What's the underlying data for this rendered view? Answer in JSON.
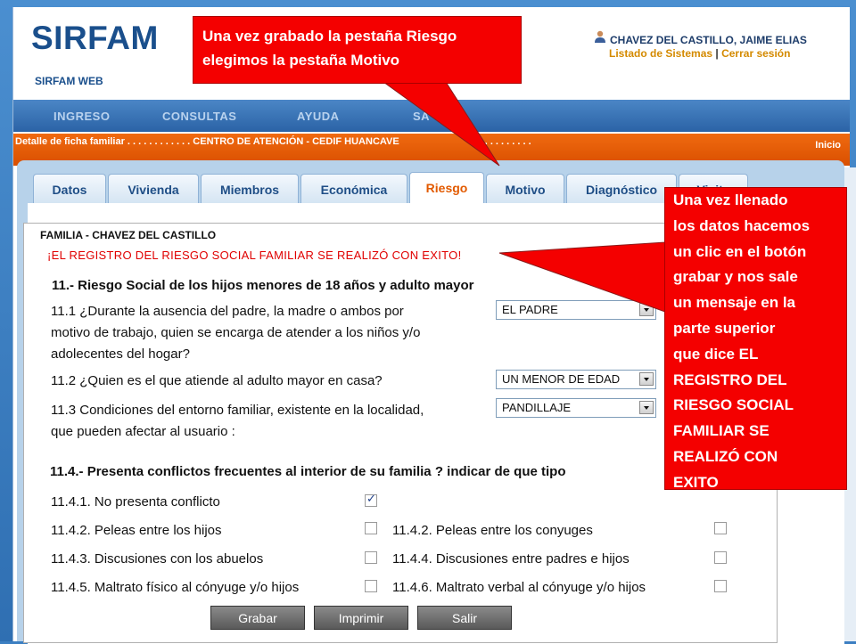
{
  "app": {
    "logo": "SIRFAM",
    "subtitle": "SIRFAM WEB",
    "user_name": "CHAVEZ DEL CASTILLO, JAIME ELIAS",
    "link_systems": "Listado de Sistemas",
    "link_separator": "|",
    "link_logout": "Cerrar sesión"
  },
  "nav": {
    "items": [
      "INGRESO",
      "CONSULTAS",
      "AYUDA",
      "SA"
    ]
  },
  "breadcrumb": {
    "text": "Detalle de ficha familiar . . . . . . . . . . . . CENTRO DE ATENCIÓN - CEDIF HUANCAVE",
    "dots": ". . . . . . . . .",
    "home": "Inicio"
  },
  "tabs": [
    "Datos",
    "Vivienda",
    "Miembros",
    "Económica",
    "Riesgo",
    "Motivo",
    "Diagnóstico",
    "Visita"
  ],
  "active_tab": "Riesgo",
  "form": {
    "family": "FAMILIA - CHAVEZ DEL CASTILLO",
    "success_message": "¡EL REGISTRO DEL RIESGO SOCIAL FAMILIAR SE REALIZÓ CON EXITO!",
    "section_11": "11.- Riesgo Social de los hijos menores de 18 años y adulto mayor",
    "q11_1": [
      "11.1 ¿Durante la ausencia del padre, la madre o ambos por",
      "motivo de trabajo, quien se encarga de atender a los niños y/o",
      "adolecentes del hogar?"
    ],
    "q11_1_value": "EL PADRE",
    "q11_2": "11.2 ¿Quien es el que atiende al adulto mayor en casa?",
    "q11_2_value": "UN MENOR DE EDAD",
    "q11_3": [
      "11.3 Condiciones del entorno familiar, existente en la localidad,",
      "que pueden afectar al usuario :"
    ],
    "q11_3_value": "PANDILLAJE",
    "section_114": "11.4.- Presenta conflictos frecuentes al interior de su familia ? indicar de que tipo",
    "conflicts": [
      {
        "label": "11.4.1. No presenta conflicto",
        "checked": true
      },
      {
        "label": "11.4.2. Peleas entre los hijos",
        "checked": false
      },
      {
        "label": "11.4.2. Peleas entre los conyuges",
        "checked": false
      },
      {
        "label": "11.4.3. Discusiones con los abuelos",
        "checked": false
      },
      {
        "label": "11.4.4. Discusiones entre padres e hijos",
        "checked": false
      },
      {
        "label": "11.4.5. Maltrato físico al cónyuge y/o hijos",
        "checked": false
      },
      {
        "label": "11.4.6. Maltrato verbal al cónyuge y/o hijos",
        "checked": false
      }
    ]
  },
  "buttons": {
    "save": "Grabar",
    "print": "Imprimir",
    "exit": "Salir"
  },
  "callouts": {
    "top": [
      "Una vez grabado la pestaña Riesgo",
      "elegimos la pestaña Motivo"
    ],
    "right": [
      "Una vez llenado",
      "los datos hacemos",
      "un clic en el botón",
      "grabar y nos sale",
      "un mensaje en la",
      "parte superior",
      "que dice EL",
      "REGISTRO DEL",
      "RIESGO SOCIAL",
      "FAMILIAR  SE",
      "REALIZÓ CON",
      "EXITO"
    ]
  },
  "colors": {
    "brand_blue": "#1a4f8c",
    "breadcrumb_orange": "#e85c08",
    "callout_red": "#f40000",
    "success_red": "#e00000",
    "active_tab": "#e25a00"
  }
}
